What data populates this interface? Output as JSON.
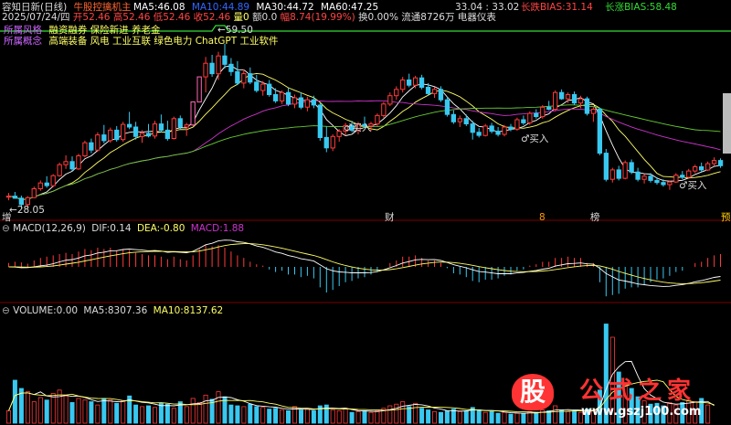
{
  "header": {
    "title": "容知日新(日线)",
    "indicator_name": "牛股控擒机主",
    "ma5": {
      "label": "MA5:",
      "value": "46.08",
      "color": "#ffffff"
    },
    "ma10": {
      "label": "MA10:",
      "value": "44.89",
      "color": "#3366ff"
    },
    "ma30": {
      "label": "MA30:",
      "value": "44.72",
      "color": "#ffffff"
    },
    "ma60": {
      "label": "MA60:",
      "value": "47.25",
      "color": "#ffffff"
    },
    "price_a": "33.04",
    "price_b": "33.02",
    "short_bias_label": "长跌BIAS:",
    "short_bias_value": "31.14",
    "long_bias_label": "长涨BIAS:",
    "long_bias_value": "58.48"
  },
  "quote_row": {
    "date": "2025/07/24/四",
    "open": "开52.46",
    "high": "高52.46",
    "low": "低52.46",
    "close": "收52.46",
    "volume": "量0",
    "amount": "额0.0",
    "change": "幅8.74(19.99%)",
    "turnover": "换0.00%",
    "circulation": "流通8726万",
    "industry": "电器仪表"
  },
  "concepts": {
    "style_label": "所属风格",
    "style_values": "融资融券 保险新进 养老金",
    "concept_label": "所属概念",
    "concept_values": "高端装备 风电 工业互联 绿色电力 ChatGPT 工业软件"
  },
  "annotations": {
    "high_price": "59.50",
    "low_price": "28.05",
    "buy_label": "买入",
    "markers": [
      "增",
      "财",
      "8",
      "榜",
      "预"
    ]
  },
  "macd_panel": {
    "title": "MACD(12,26,9)",
    "dif_label": "DIF:",
    "dif_value": "0.14",
    "dea_label": "DEA:",
    "dea_value": "-0.80",
    "macd_label": "MACD:",
    "macd_value": "1.88"
  },
  "volume_panel": {
    "title": "VOLUME:",
    "volume_value": "0.00",
    "ma5_label": "MA5:",
    "ma5_value": "8307.36",
    "ma10_label": "MA10:",
    "ma10_value": "8137.62"
  },
  "watermark": {
    "text": "公式之家",
    "url": "www.gszj100.com",
    "logo_char": "股"
  },
  "colors": {
    "up": "#ff3b3b",
    "down": "#38c8f0",
    "limit_up": "#ff69b4",
    "big_up": "#33dd33",
    "ma_white": "#ffffff",
    "ma_yellow": "#ffff66",
    "ma_green": "#66cc33",
    "ma_purple": "#cc33cc"
  },
  "chart_data": [
    {
      "type": "candlestick",
      "price_range": [
        28.05,
        59.5
      ],
      "candles": [
        [
          30.2,
          31.0,
          29.6,
          30.4
        ],
        [
          30.4,
          31.2,
          29.9,
          30.0
        ],
        [
          30.0,
          30.5,
          28.1,
          28.8
        ],
        [
          28.8,
          30.4,
          28.05,
          30.1
        ],
        [
          30.1,
          32.2,
          30.0,
          31.8
        ],
        [
          31.8,
          33.4,
          31.4,
          32.9
        ],
        [
          32.9,
          34.2,
          32.0,
          32.4
        ],
        [
          32.4,
          34.6,
          32.1,
          34.3
        ],
        [
          34.3,
          36.8,
          34.1,
          36.4
        ],
        [
          36.4,
          38.2,
          35.6,
          37.0
        ],
        [
          37.0,
          38.0,
          35.2,
          35.6
        ],
        [
          35.6,
          38.5,
          35.4,
          38.1
        ],
        [
          38.1,
          41.0,
          37.8,
          40.6
        ],
        [
          40.6,
          41.4,
          38.6,
          39.2
        ],
        [
          39.2,
          42.6,
          38.9,
          42.1
        ],
        [
          42.1,
          44.0,
          40.5,
          41.0
        ],
        [
          41.0,
          43.5,
          40.6,
          43.0
        ],
        [
          43.0,
          43.8,
          40.8,
          41.2
        ],
        [
          41.2,
          44.6,
          40.8,
          44.1
        ],
        [
          44.1,
          46.5,
          43.2,
          43.6
        ],
        [
          43.6,
          44.6,
          41.2,
          41.8
        ],
        [
          41.8,
          43.0,
          40.6,
          42.4
        ],
        [
          42.4,
          44.2,
          41.6,
          41.9
        ],
        [
          41.9,
          44.8,
          41.4,
          44.2
        ],
        [
          44.2,
          46.0,
          42.6,
          43.0
        ],
        [
          43.0,
          44.8,
          41.0,
          41.4
        ],
        [
          41.4,
          45.6,
          41.2,
          45.2
        ],
        [
          45.2,
          45.8,
          43.1,
          43.6
        ],
        [
          43.6,
          44.4,
          41.9,
          44.0
        ],
        [
          44.0,
          48.4,
          43.8,
          48.4
        ],
        [
          48.4,
          53.2,
          48.4,
          53.2
        ],
        [
          53.2,
          57.0,
          50.2,
          55.8
        ],
        [
          55.8,
          57.4,
          53.2,
          53.8
        ],
        [
          53.8,
          58.0,
          52.6,
          57.2
        ],
        [
          57.2,
          59.5,
          54.8,
          55.6
        ],
        [
          55.6,
          56.8,
          53.4,
          54.2
        ],
        [
          54.2,
          56.2,
          51.6,
          52.0
        ],
        [
          52.0,
          54.6,
          51.0,
          53.8
        ],
        [
          53.8,
          55.0,
          51.8,
          52.2
        ],
        [
          52.2,
          53.6,
          50.2,
          50.6
        ],
        [
          50.6,
          52.4,
          49.6,
          51.8
        ],
        [
          51.8,
          52.6,
          49.4,
          49.8
        ],
        [
          49.8,
          51.0,
          48.2,
          48.6
        ],
        [
          48.6,
          50.6,
          48.0,
          50.2
        ],
        [
          50.2,
          51.0,
          47.6,
          48.0
        ],
        [
          48.0,
          49.8,
          47.2,
          49.2
        ],
        [
          49.2,
          50.2,
          47.0,
          47.4
        ],
        [
          47.4,
          49.4,
          46.6,
          48.8
        ],
        [
          48.8,
          49.6,
          47.2,
          47.8
        ],
        [
          47.8,
          48.2,
          41.0,
          41.6
        ],
        [
          41.6,
          43.8,
          38.8,
          39.6
        ],
        [
          39.6,
          42.2,
          39.0,
          41.8
        ],
        [
          41.8,
          43.2,
          40.8,
          42.8
        ],
        [
          42.8,
          44.4,
          42.0,
          43.9
        ],
        [
          43.9,
          44.8,
          42.6,
          43.0
        ],
        [
          43.0,
          44.6,
          42.2,
          44.1
        ],
        [
          44.1,
          45.6,
          43.4,
          43.8
        ],
        [
          43.8,
          44.6,
          42.8,
          44.2
        ],
        [
          44.2,
          46.2,
          43.8,
          45.8
        ],
        [
          45.8,
          48.4,
          45.4,
          48.0
        ],
        [
          48.0,
          50.2,
          47.6,
          49.6
        ],
        [
          49.6,
          51.4,
          48.8,
          50.8
        ],
        [
          50.8,
          53.2,
          50.2,
          52.6
        ],
        [
          52.6,
          53.8,
          51.2,
          51.6
        ],
        [
          51.6,
          53.4,
          51.0,
          53.0
        ],
        [
          53.0,
          53.6,
          50.8,
          51.2
        ],
        [
          51.2,
          52.0,
          49.6,
          50.0
        ],
        [
          50.0,
          51.2,
          49.2,
          50.8
        ],
        [
          50.8,
          51.4,
          48.4,
          48.8
        ],
        [
          48.8,
          49.4,
          45.6,
          46.0
        ],
        [
          46.0,
          46.8,
          44.2,
          44.6
        ],
        [
          44.6,
          45.8,
          43.6,
          45.2
        ],
        [
          45.2,
          46.0,
          43.8,
          44.2
        ],
        [
          44.2,
          44.8,
          41.2,
          42.6
        ],
        [
          42.6,
          43.4,
          41.6,
          42.0
        ],
        [
          42.0,
          44.2,
          41.8,
          43.8
        ],
        [
          43.8,
          44.4,
          42.4,
          42.8
        ],
        [
          42.8,
          43.6,
          41.8,
          42.2
        ],
        [
          42.2,
          44.0,
          41.8,
          43.6
        ],
        [
          43.6,
          44.2,
          42.8,
          43.2
        ],
        [
          43.2,
          45.4,
          42.9,
          45.0
        ],
        [
          45.0,
          45.8,
          44.0,
          44.4
        ],
        [
          44.4,
          46.6,
          44.0,
          46.2
        ],
        [
          46.2,
          47.0,
          45.2,
          45.6
        ],
        [
          45.6,
          47.8,
          45.2,
          47.4
        ],
        [
          47.4,
          48.6,
          46.8,
          47.0
        ],
        [
          47.0,
          50.6,
          46.6,
          50.2
        ],
        [
          50.2,
          50.8,
          48.8,
          49.0
        ],
        [
          49.0,
          50.2,
          48.2,
          49.8
        ],
        [
          49.8,
          50.4,
          47.8,
          48.2
        ],
        [
          48.2,
          49.6,
          47.2,
          49.0
        ],
        [
          49.0,
          49.4,
          45.8,
          46.2
        ],
        [
          46.2,
          47.4,
          44.6,
          47.0
        ],
        [
          47.0,
          47.2,
          38.2,
          38.6
        ],
        [
          38.6,
          39.4,
          33.2,
          33.6
        ],
        [
          33.6,
          35.8,
          33.0,
          35.4
        ],
        [
          35.4,
          36.2,
          33.4,
          33.8
        ],
        [
          33.8,
          37.2,
          33.6,
          36.8
        ],
        [
          36.8,
          37.4,
          34.6,
          35.0
        ],
        [
          35.0,
          35.8,
          33.2,
          33.6
        ],
        [
          33.6,
          34.6,
          32.8,
          34.2
        ],
        [
          34.2,
          34.8,
          33.0,
          33.4
        ],
        [
          33.4,
          34.0,
          32.6,
          33.0
        ],
        [
          33.0,
          33.6,
          32.2,
          32.6
        ],
        [
          32.6,
          33.4,
          31.6,
          33.1
        ],
        [
          33.1,
          34.8,
          32.9,
          34.4
        ],
        [
          34.4,
          35.2,
          33.6,
          34.0
        ],
        [
          34.0,
          35.6,
          33.8,
          35.2
        ],
        [
          35.2,
          36.4,
          34.8,
          36.0
        ],
        [
          36.0,
          36.8,
          35.0,
          35.4
        ],
        [
          35.4,
          37.0,
          35.2,
          36.6
        ],
        [
          36.6,
          37.8,
          36.2,
          37.2
        ],
        [
          37.2,
          37.6,
          35.8,
          36.2
        ]
      ],
      "ma_lines": [
        "MA5",
        "MA10",
        "MA30",
        "MA60"
      ]
    },
    {
      "type": "bar",
      "series_name": "MACD",
      "values": [
        0.3,
        0.4,
        0.35,
        0.25,
        0.5,
        0.7,
        0.8,
        0.9,
        1.0,
        1.1,
        1.0,
        1.2,
        1.4,
        1.3,
        1.5,
        1.4,
        1.5,
        1.3,
        1.4,
        1.3,
        1.1,
        1.0,
        0.9,
        0.9,
        0.8,
        0.6,
        0.8,
        0.6,
        0.5,
        0.9,
        1.4,
        1.7,
        1.6,
        1.7,
        1.5,
        1.2,
        0.9,
        0.7,
        0.4,
        0.2,
        0.1,
        -0.2,
        -0.4,
        -0.3,
        -0.6,
        -0.6,
        -0.8,
        -0.7,
        -0.9,
        -1.6,
        -2.0,
        -1.8,
        -1.5,
        -1.2,
        -1.1,
        -0.9,
        -0.8,
        -0.6,
        -0.4,
        0.0,
        0.3,
        0.5,
        0.8,
        0.8,
        0.9,
        0.7,
        0.5,
        0.5,
        0.3,
        -0.1,
        -0.5,
        -0.6,
        -0.8,
        -1.1,
        -1.2,
        -1.0,
        -1.0,
        -0.9,
        -0.7,
        -0.6,
        -0.3,
        -0.2,
        0.1,
        0.2,
        0.4,
        0.4,
        0.7,
        0.7,
        0.8,
        0.7,
        0.7,
        0.3,
        0.3,
        -1.2,
        -2.3,
        -2.2,
        -2.1,
        -1.7,
        -1.6,
        -1.6,
        -1.4,
        -1.2,
        -1.0,
        -0.9,
        -0.7,
        -0.4,
        -0.3,
        0.0,
        0.3,
        0.4,
        0.7,
        0.9,
        1.0
      ]
    },
    {
      "type": "bar",
      "series_name": "VOLUME",
      "values": [
        1500,
        5200,
        4200,
        3800,
        2600,
        3100,
        2800,
        3600,
        4000,
        3300,
        2500,
        3000,
        2800,
        2600,
        2200,
        3000,
        2800,
        2400,
        2700,
        3300,
        2200,
        2000,
        2100,
        1900,
        2400,
        2300,
        1800,
        2600,
        2000,
        3000,
        2500,
        3400,
        2900,
        3800,
        3200,
        2200,
        2100,
        2000,
        2300,
        2000,
        1900,
        1700,
        1800,
        1600,
        1500,
        2000,
        1600,
        1700,
        1500,
        2100,
        2200,
        1600,
        1500,
        1700,
        1300,
        1400,
        1500,
        1300,
        1500,
        1800,
        2100,
        2300,
        2600,
        2000,
        2400,
        1800,
        1600,
        1400,
        1300,
        1500,
        1700,
        1400,
        1500,
        1900,
        1600,
        1300,
        1400,
        1200,
        1300,
        1100,
        1200,
        1200,
        1400,
        1300,
        1600,
        1500,
        2100,
        1600,
        1400,
        1500,
        1300,
        1700,
        1500,
        4000,
        12000,
        10400,
        6200,
        4600,
        4200,
        3200,
        2700,
        2300,
        2400,
        2100,
        2500,
        2200,
        2500,
        2800,
        2600,
        3000,
        2200,
        0
      ]
    }
  ]
}
